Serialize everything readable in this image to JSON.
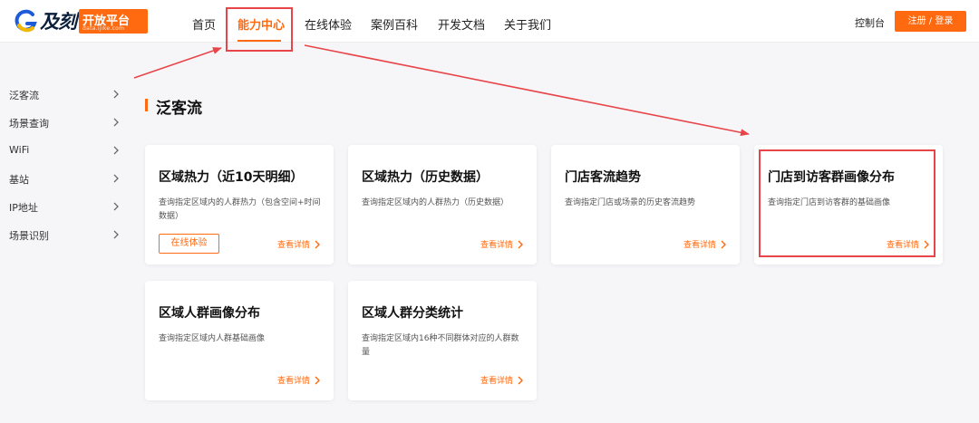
{
  "header": {
    "logo_text": "及刻",
    "logo_badge": "开放平台",
    "logo_sub": "data.ijike.com",
    "nav": [
      "首页",
      "能力中心",
      "在线体验",
      "案例百科",
      "开发文档",
      "关于我们"
    ],
    "console": "控制台",
    "register_login": "注册 / 登录"
  },
  "sidebar": {
    "items": [
      {
        "label": "泛客流"
      },
      {
        "label": "场景查询"
      },
      {
        "label": "WiFi"
      },
      {
        "label": "基站"
      },
      {
        "label": "IP地址"
      },
      {
        "label": "场景识别"
      }
    ]
  },
  "main": {
    "section_title": "泛客流",
    "more_label": "查看详情",
    "try_label": "在线体验",
    "cards": [
      {
        "title": "区域热力（近10天明细）",
        "desc": "查询指定区域内的人群热力（包含空间+时间数据）"
      },
      {
        "title": "区域热力（历史数据）",
        "desc": "查询指定区域内的人群热力（历史数据）"
      },
      {
        "title": "门店客流趋势",
        "desc": "查询指定门店或场景的历史客流趋势"
      },
      {
        "title": "门店到访客群画像分布",
        "desc": "查询指定门店到访客群的基础画像"
      },
      {
        "title": "区域人群画像分布",
        "desc": "查询指定区域内人群基础画像"
      },
      {
        "title": "区域人群分类统计",
        "desc": "查询指定区域内16种不同群体对应的人群数量"
      }
    ]
  },
  "colors": {
    "accent": "#ff6a10",
    "annotation": "#e8454a"
  },
  "icons": {
    "sidebar_chevron": "chevron-right-icon",
    "more_chevron": "chevron-right-icon",
    "annotation_arrow": "arrow-icon"
  }
}
